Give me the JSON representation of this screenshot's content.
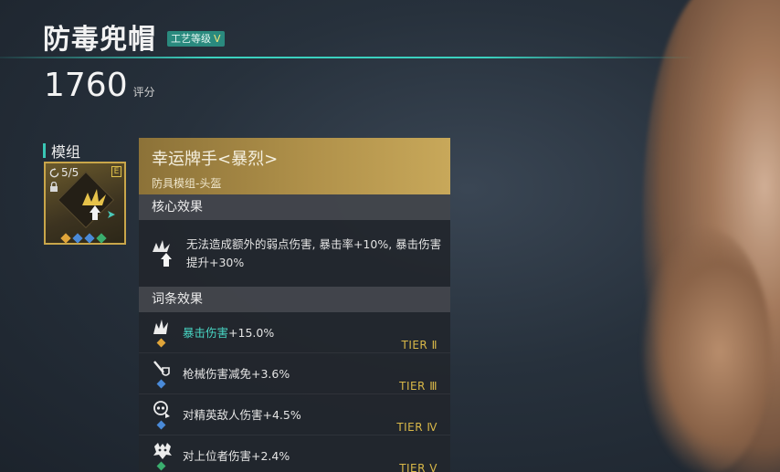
{
  "item": {
    "title": "防毒兜帽",
    "grade_label": "工艺等级",
    "grade_level": "V",
    "score": "1760",
    "score_unit": "评分"
  },
  "module_section": {
    "label": "模组",
    "count": "5/5",
    "rarity_badge": "E",
    "icon": "crit-burst-arrow-icon",
    "gem_colors": [
      "#e0a53a",
      "#4a8ad8",
      "#4a8ad8",
      "#3aae6e"
    ]
  },
  "panel": {
    "title": "幸运牌手<暴烈>",
    "subtitle": "防具模组-头盔",
    "core_header": "核心效果",
    "core_text": "无法造成额外的弱点伤害, 暴击率+10%, 暴击伤害提升+30%",
    "affix_header": "词条效果",
    "affixes": [
      {
        "highlight": "暴击伤害",
        "text": "+15.0%",
        "tier": "TIER Ⅱ",
        "gem_color": "#e0a53a",
        "icon": "crit-burst-icon"
      },
      {
        "highlight": "",
        "text": "枪械伤害减免+3.6%",
        "tier": "TIER Ⅲ",
        "gem_color": "#4a8ad8",
        "icon": "gun-shield-icon"
      },
      {
        "highlight": "",
        "text": "对精英敌人伤害+4.5%",
        "tier": "TIER Ⅳ",
        "gem_color": "#4a8ad8",
        "icon": "elite-skull-icon"
      },
      {
        "highlight": "",
        "text": "对上位者伤害+2.4%",
        "tier": "TIER Ⅴ",
        "gem_color": "#3aae6e",
        "icon": "boss-beast-icon"
      }
    ]
  },
  "colors": {
    "accent_teal": "#39c7b5",
    "gold": "#c9a64a",
    "tier_gold": "#d9b848"
  }
}
